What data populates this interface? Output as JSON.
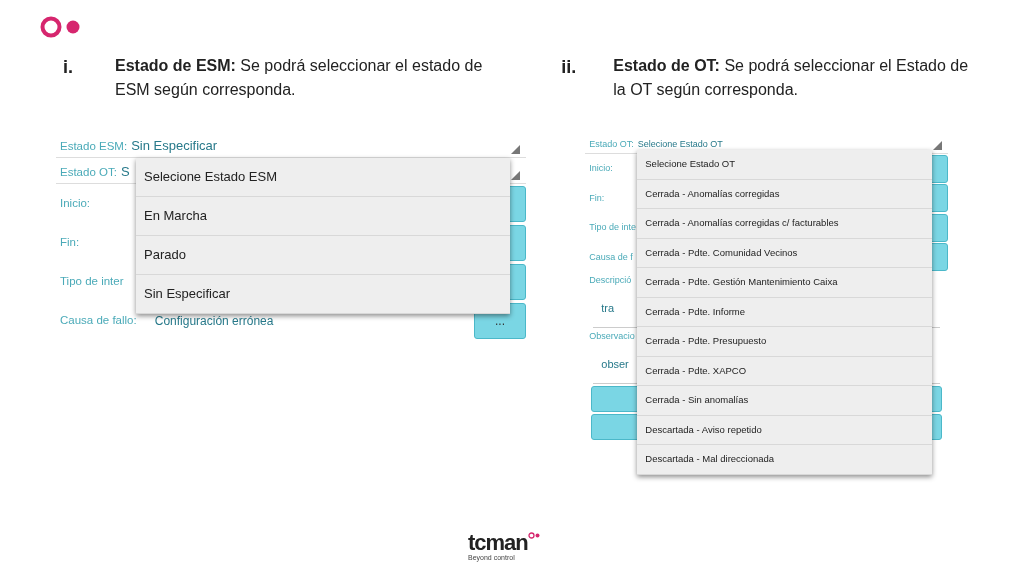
{
  "slide": {
    "bullets": [
      {
        "marker": "i.",
        "text": "**Estado de ESM:** Se podrá seleccionar el estado de ESM según corresponda."
      },
      {
        "marker": "ii.",
        "text": "**Estado de OT:** Se podrá seleccionar el Estado de la OT según corresponda."
      }
    ]
  },
  "screens": [
    {
      "fields": [
        {
          "kind": "select",
          "label": "Estado ESM:",
          "value": "Sin Especificar"
        },
        {
          "kind": "select",
          "label": "Estado OT:",
          "value": "S"
        },
        {
          "kind": "button-row",
          "label": "Inicio:"
        },
        {
          "kind": "button-row",
          "label": "Fin:"
        },
        {
          "kind": "button-row",
          "label": "Tipo de inter"
        },
        {
          "kind": "button-row",
          "label": "Causa de fallo:",
          "value": "Configuración errónea",
          "button": "..."
        }
      ],
      "dropdown": {
        "options": [
          "Selecione Estado  ESM",
          "En Marcha",
          "Parado",
          "Sin Especificar"
        ]
      }
    },
    {
      "fields": [
        {
          "kind": "select",
          "label": "Estado OT:",
          "value": "Selecione Estado  OT"
        },
        {
          "kind": "button-row",
          "label": "Inicio:"
        },
        {
          "kind": "button-row",
          "label": "Fin:"
        },
        {
          "kind": "button-row",
          "label": "Tipo de inte"
        },
        {
          "kind": "button-row",
          "label": "Causa de f"
        },
        {
          "kind": "caption",
          "label": "Descripció"
        },
        {
          "kind": "textarea",
          "value": "tra"
        },
        {
          "kind": "caption",
          "label": "Observacio"
        },
        {
          "kind": "textarea",
          "value": "obser"
        },
        {
          "kind": "action"
        },
        {
          "kind": "action"
        }
      ],
      "dropdown": {
        "options": [
          "Selecione Estado  OT",
          "Cerrada - Anomalías corregidas",
          "Cerrada - Anomalías corregidas c/ facturables",
          "Cerrada - Pdte. Comunidad Vecinos",
          "Cerrada - Pdte. Gestión Mantenimiento Caixa",
          "Cerrada - Pdte. Informe",
          "Cerrada - Pdte. Presupuesto",
          "Cerrada - Pdte. XAPCO",
          "Cerrada - Sin anomalías",
          "Descartada - Aviso repetido",
          "Descartada - Mal direccionada"
        ]
      }
    }
  ],
  "footer": {
    "brand": "tcman",
    "tagline": "Beyond control"
  }
}
